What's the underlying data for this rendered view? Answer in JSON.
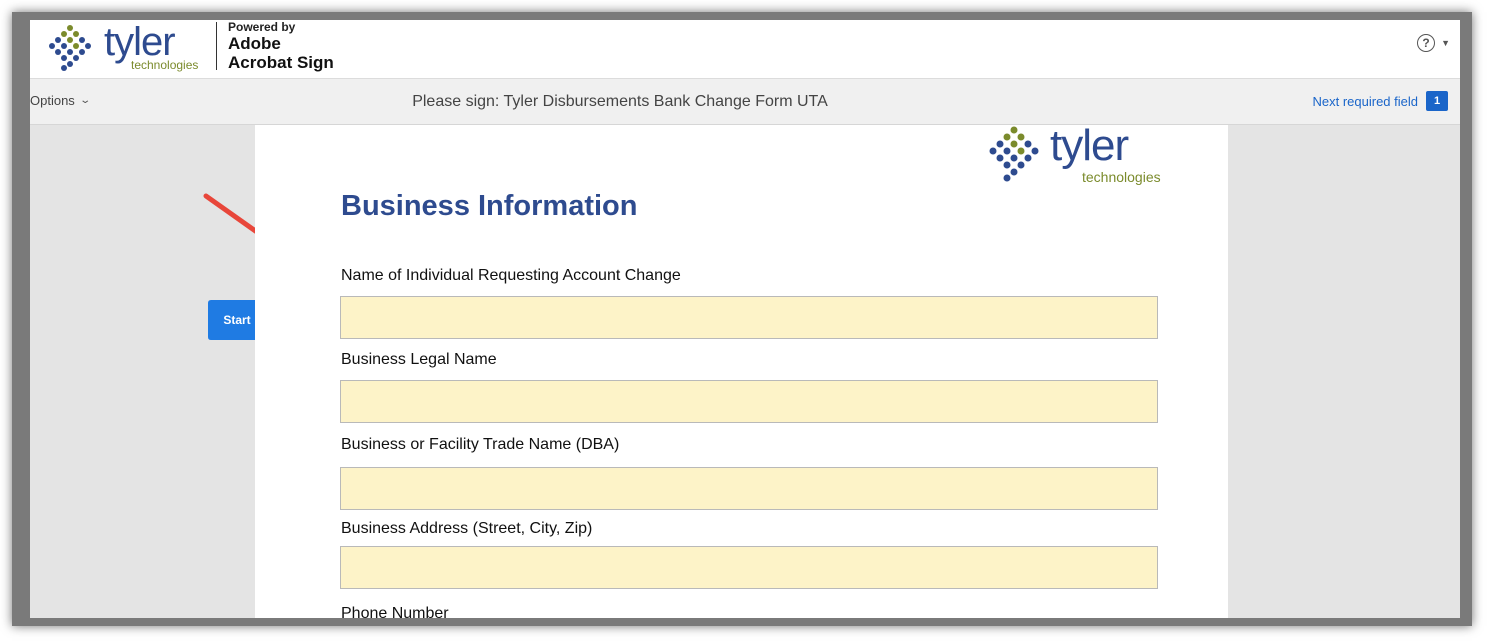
{
  "header": {
    "logo_word": "tyler",
    "logo_sub": "technologies",
    "powered_by": "Powered by",
    "powered_line1": "Adobe",
    "powered_line2": "Acrobat Sign",
    "help_icon": "?"
  },
  "toolbar": {
    "options_label": "Options",
    "document_title": "Please sign: Tyler Disbursements Bank Change Form UTA",
    "next_required_label": "Next required field",
    "next_required_count": "1"
  },
  "document": {
    "logo_word": "tyler",
    "logo_sub": "technologies",
    "section_title": "Business Information",
    "fields": [
      {
        "label": "Name of Individual Requesting Account Change",
        "value": ""
      },
      {
        "label": "Business Legal Name",
        "value": ""
      },
      {
        "label": "Business or Facility Trade Name (DBA)",
        "value": ""
      },
      {
        "label": "Business Address (Street, City, Zip)",
        "value": ""
      },
      {
        "label": "Phone Number",
        "value": ""
      }
    ]
  },
  "start_tag": {
    "label": "Start"
  },
  "colors": {
    "brand_blue": "#2e4b8f",
    "brand_green": "#7b8b2c",
    "field_fill": "#fdf3c8",
    "start_blue": "#1f7be3",
    "link_blue": "#1a65c9",
    "annotation_red": "#e8463a"
  }
}
